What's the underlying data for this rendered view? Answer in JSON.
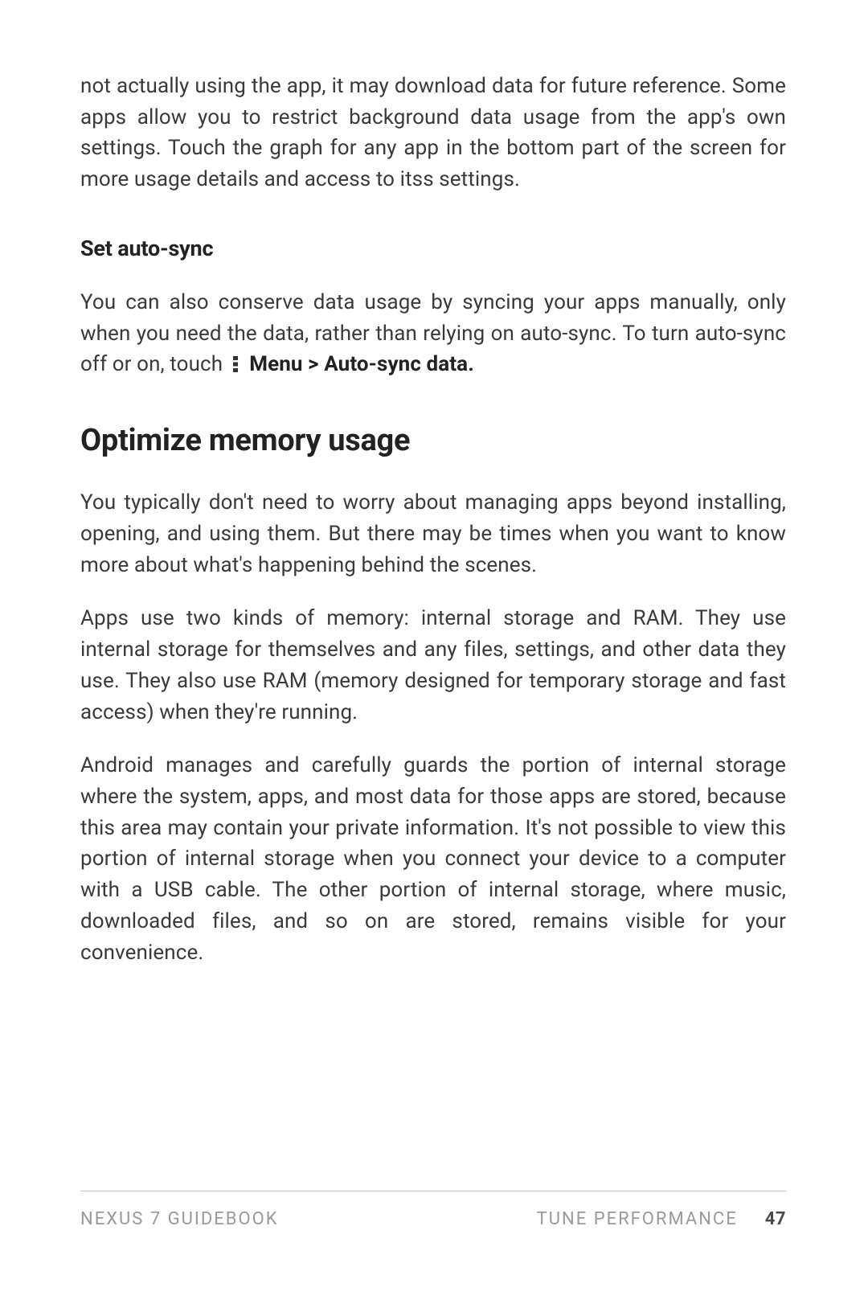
{
  "paragraphs": {
    "intro_continuation": "not actually using the app, it may download data for future reference. Some apps allow you to restrict background data usage from the app's own settings. Touch the graph for any app in the bottom part of the screen for more usage details and access to itss settings."
  },
  "autosync": {
    "heading": "Set auto-sync",
    "para_prefix": "You can also conserve data usage by syncing your apps manually, only when you need the data, rather than relying on auto-sync. To turn auto-sync off or on, touch ",
    "menu_path": "Menu > Auto-sync data."
  },
  "optimize": {
    "heading": "Optimize memory usage",
    "p1": "You typically don't need to worry about managing apps beyond installing, opening, and using them. But there may be times when you want to know more about what's happening behind the scenes.",
    "p2": "Apps use two kinds of memory: internal storage and RAM. They use internal storage for themselves and any files, settings, and other data they use. They also use RAM (memory designed for temporary storage and fast access) when they're running.",
    "p3": "Android manages and carefully guards the portion of internal storage where the system, apps, and most data for those apps are stored, because this area may contain your private information. It's not possible to view this portion of internal storage when you connect your device to a computer with a USB cable. The other portion of internal storage, where music, downloaded files, and so on are stored, remains visible for your convenience."
  },
  "footer": {
    "book_title": "NEXUS 7 GUIDEBOOK",
    "section_title": "TUNE PERFORMANCE",
    "page_number": "47"
  }
}
